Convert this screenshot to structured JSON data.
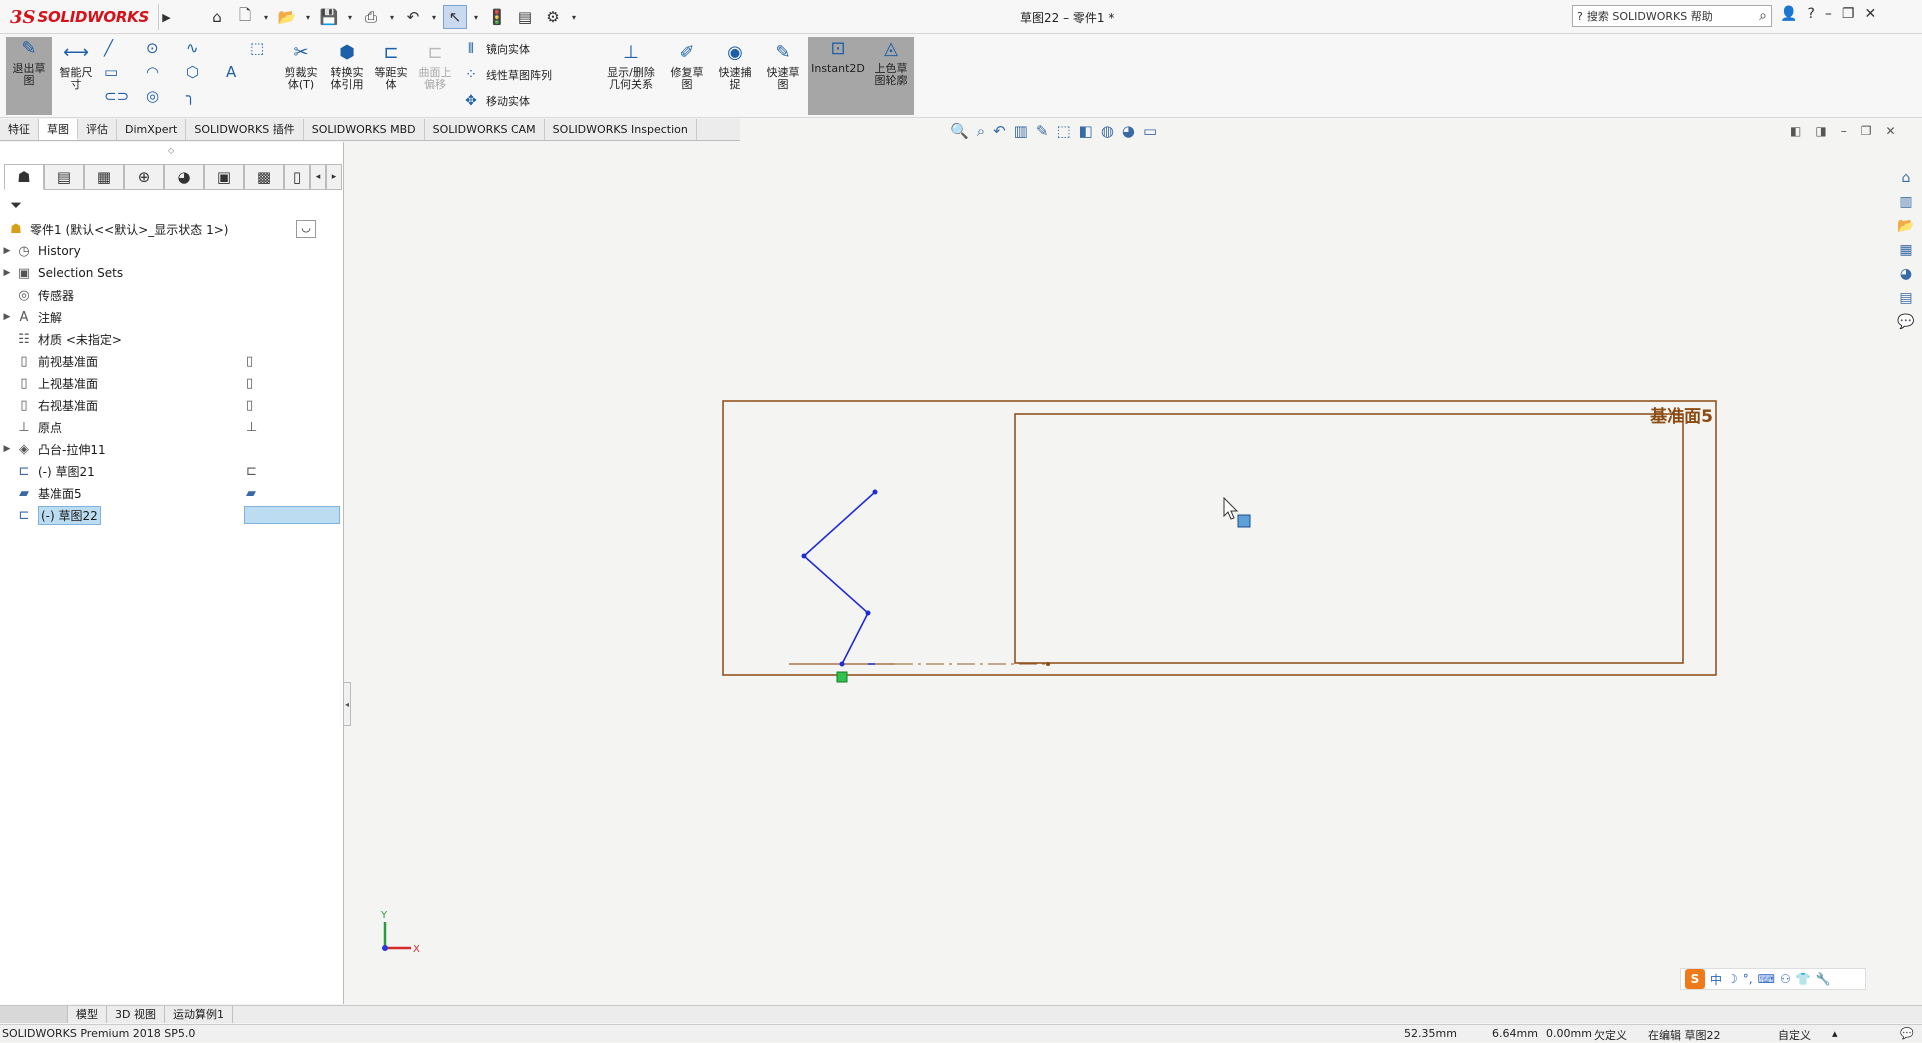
{
  "app": {
    "logo_ds": "3S",
    "logo_text": "SOLIDWORKS",
    "doc_title": "草图22 – 零件1 *",
    "search_placeholder": "搜索 SOLIDWORKS 帮助"
  },
  "quickbar": {
    "icons": [
      "home-icon",
      "new-document-icon",
      "open-icon",
      "save-icon",
      "print-icon",
      "undo-icon",
      "select-icon",
      "rebuild-icon",
      "file-properties-icon",
      "options-icon"
    ]
  },
  "commands": {
    "exit_sketch": "退出草图",
    "smart_dimension": "智能尺寸",
    "trim": "剪裁实体(T)",
    "convert": "转换实体引用",
    "offset": "等距实体",
    "surface_offset": "曲面上偏移",
    "mirror": "镜向实体",
    "linear_pattern": "线性草图阵列",
    "move": "移动实体",
    "relations": "显示/删除几何关系",
    "repair": "修复草图",
    "quick_snap": "快速捕捉",
    "rapid_sketch": "快速草图",
    "instant2d": "Instant2D",
    "shaded_contours": "上色草图轮廓"
  },
  "tabs": [
    "特征",
    "草图",
    "评估",
    "DimXpert",
    "SOLIDWORKS 插件",
    "SOLIDWORKS MBD",
    "SOLIDWORKS CAM",
    "SOLIDWORKS Inspection"
  ],
  "active_tab": 1,
  "tree": {
    "root": "零件1 (默认<<默认>_显示状态 1>)",
    "items": [
      {
        "label": "History",
        "icon": "history-icon",
        "expandable": true
      },
      {
        "label": "Selection Sets",
        "icon": "selection-sets-icon",
        "expandable": true
      },
      {
        "label": "传感器",
        "icon": "sensor-icon",
        "expandable": false
      },
      {
        "label": "注解",
        "icon": "annotation-icon",
        "expandable": true
      },
      {
        "label": "材质 <未指定>",
        "icon": "material-icon",
        "expandable": false
      },
      {
        "label": "前视基准面",
        "icon": "plane-icon",
        "expandable": false
      },
      {
        "label": "上视基准面",
        "icon": "plane-icon",
        "expandable": false
      },
      {
        "label": "右视基准面",
        "icon": "plane-icon",
        "expandable": false
      },
      {
        "label": "原点",
        "icon": "origin-icon",
        "expandable": false
      },
      {
        "label": "凸台-拉伸11",
        "icon": "extrude-icon",
        "expandable": true
      },
      {
        "label": "(-) 草图21",
        "icon": "sketch-icon",
        "expandable": false
      },
      {
        "label": "基准面5",
        "icon": "plane5-icon",
        "expandable": false
      },
      {
        "label": "(-) 草图22",
        "icon": "sketch-icon",
        "expandable": false,
        "selected": true
      }
    ]
  },
  "graphics": {
    "plane_label": "基准面5",
    "axis_x": "X",
    "axis_y": "Y",
    "plane_color": "#8b4a12",
    "sketch_color": "#1f2bd6"
  },
  "bottom_tabs": [
    "模型",
    "3D 视图",
    "运动算例1"
  ],
  "status": {
    "product": "SOLIDWORKS Premium 2018 SP5.0",
    "x": "52.35mm",
    "y": "6.64mm",
    "z": "0.00mm",
    "state": "欠定义",
    "editing": "在编辑 草图22",
    "units": "自定义"
  },
  "ime": {
    "logo": "S",
    "mode": "中"
  }
}
